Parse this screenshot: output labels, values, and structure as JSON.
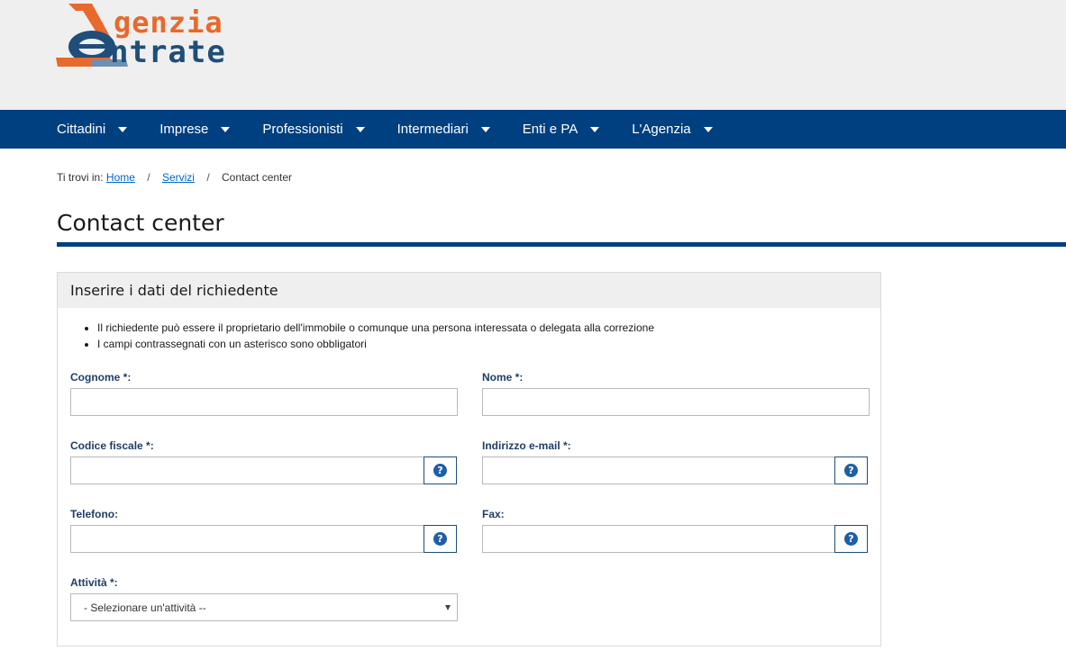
{
  "logo": {
    "line1": "genzia",
    "line2": "ntrate",
    "brand_orange": "#e7692c",
    "brand_blue": "#1f4e79"
  },
  "nav": {
    "items": [
      {
        "label": "Cittadini"
      },
      {
        "label": "Imprese"
      },
      {
        "label": "Professionisti"
      },
      {
        "label": "Intermediari"
      },
      {
        "label": "Enti e PA"
      },
      {
        "label": "L'Agenzia"
      }
    ],
    "background": "#004080"
  },
  "breadcrumb": {
    "prefix": "Ti trovi in:",
    "home": "Home",
    "sep": "/",
    "servizi": "Servizi",
    "current": "Contact center"
  },
  "page": {
    "title": "Contact center"
  },
  "panel": {
    "heading": "Inserire i dati del richiedente",
    "notes": [
      "Il richiedente può essere il proprietario dell'immobile o comunque una persona interessata o delegata alla correzione",
      "I campi contrassegnati con un asterisco sono obbligatori"
    ],
    "fields": {
      "cognome": {
        "label": "Cognome *:",
        "value": ""
      },
      "nome": {
        "label": "Nome *:",
        "value": ""
      },
      "codice_fiscale": {
        "label": "Codice fiscale *:",
        "value": ""
      },
      "email": {
        "label": "Indirizzo e-mail *:",
        "value": ""
      },
      "telefono": {
        "label": "Telefono:",
        "value": ""
      },
      "fax": {
        "label": "Fax:",
        "value": ""
      },
      "attivita": {
        "label": "Attività *:",
        "selected": "- Selezionare un'attività --"
      }
    },
    "help_glyph": "?"
  }
}
